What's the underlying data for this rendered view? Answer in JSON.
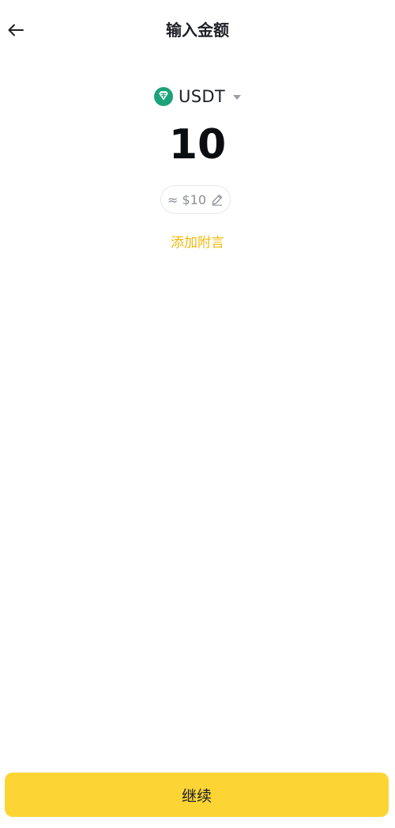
{
  "header": {
    "title": "输入金额",
    "back_icon": "arrow-left-icon"
  },
  "currency": {
    "symbol": "USDT",
    "icon": "tether-icon",
    "icon_color": "#1ba27a",
    "dropdown_icon": "caret-down-icon"
  },
  "amount": {
    "value": "10"
  },
  "fiat": {
    "approx_text": "≈ $10",
    "edit_icon": "pencil-icon"
  },
  "note": {
    "label": "添加附言",
    "color": "#f0b90b"
  },
  "footer": {
    "continue_label": "继续",
    "button_color": "#fcd535"
  }
}
